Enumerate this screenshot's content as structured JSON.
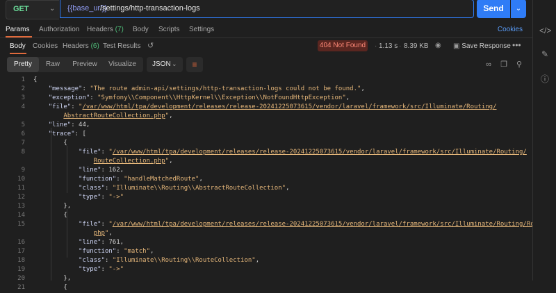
{
  "request": {
    "method": "GET",
    "url_variable": "{{base_url}}",
    "url_path": "/settings/http-transaction-logs",
    "send_label": "Send"
  },
  "request_tabs": {
    "params": "Params",
    "authorization": "Authorization",
    "headers": "Headers",
    "headers_count": "(7)",
    "body": "Body",
    "scripts": "Scripts",
    "settings": "Settings",
    "cookies": "Cookies"
  },
  "response_tabs": {
    "body": "Body",
    "cookies": "Cookies",
    "headers": "Headers",
    "headers_count": "(6)",
    "test_results": "Test Results",
    "status": "404 Not Found",
    "time": "1.13 s",
    "size": "8.39 KB",
    "save_response": "Save Response",
    "more": "•••"
  },
  "toolbar": {
    "pretty": "Pretty",
    "raw": "Raw",
    "preview": "Preview",
    "visualize": "Visualize",
    "format": "JSON"
  },
  "code_lines": [
    {
      "n": "1",
      "t": "{"
    },
    {
      "n": "2",
      "t": "    \"message\": \"The route admin-api/settings/http-transaction-logs could not be found.\","
    },
    {
      "n": "3",
      "t": "    \"exception\": \"Symfony\\\\Component\\\\HttpKernel\\\\Exception\\\\NotFoundHttpException\","
    },
    {
      "n": "4",
      "t": "    \"file\": \"/var/www/html/tpa/development/releases/release-20241225073615/vendor/laravel/framework/src/Illuminate/Routing/"
    },
    {
      "n": "",
      "t": "        AbstractRouteCollection.php\","
    },
    {
      "n": "5",
      "t": "    \"line\": 44,"
    },
    {
      "n": "6",
      "t": "    \"trace\": ["
    },
    {
      "n": "7",
      "t": "        {"
    },
    {
      "n": "8",
      "t": "            \"file\": \"/var/www/html/tpa/development/releases/release-20241225073615/vendor/laravel/framework/src/Illuminate/Routing/"
    },
    {
      "n": "",
      "t": "                RouteCollection.php\","
    },
    {
      "n": "9",
      "t": "            \"line\": 162,"
    },
    {
      "n": "10",
      "t": "            \"function\": \"handleMatchedRoute\","
    },
    {
      "n": "11",
      "t": "            \"class\": \"Illuminate\\\\Routing\\\\AbstractRouteCollection\","
    },
    {
      "n": "12",
      "t": "            \"type\": \"->\""
    },
    {
      "n": "13",
      "t": "        },"
    },
    {
      "n": "14",
      "t": "        {"
    },
    {
      "n": "15",
      "t": "            \"file\": \"/var/www/html/tpa/development/releases/release-20241225073615/vendor/laravel/framework/src/Illuminate/Routing/Router."
    },
    {
      "n": "",
      "t": "                php\","
    },
    {
      "n": "16",
      "t": "            \"line\": 761,"
    },
    {
      "n": "17",
      "t": "            \"function\": \"match\","
    },
    {
      "n": "18",
      "t": "            \"class\": \"Illuminate\\\\Routing\\\\RouteCollection\","
    },
    {
      "n": "19",
      "t": "            \"type\": \"->\""
    },
    {
      "n": "20",
      "t": "        },"
    },
    {
      "n": "21",
      "t": "        {"
    }
  ],
  "colors": {
    "accent": "#2f7cf6",
    "status_bg": "#5a2620",
    "status_text": "#ff8a78",
    "method": "#6bdd9a",
    "string": "#e6b77a",
    "tab_underline": "#e06a3c"
  }
}
